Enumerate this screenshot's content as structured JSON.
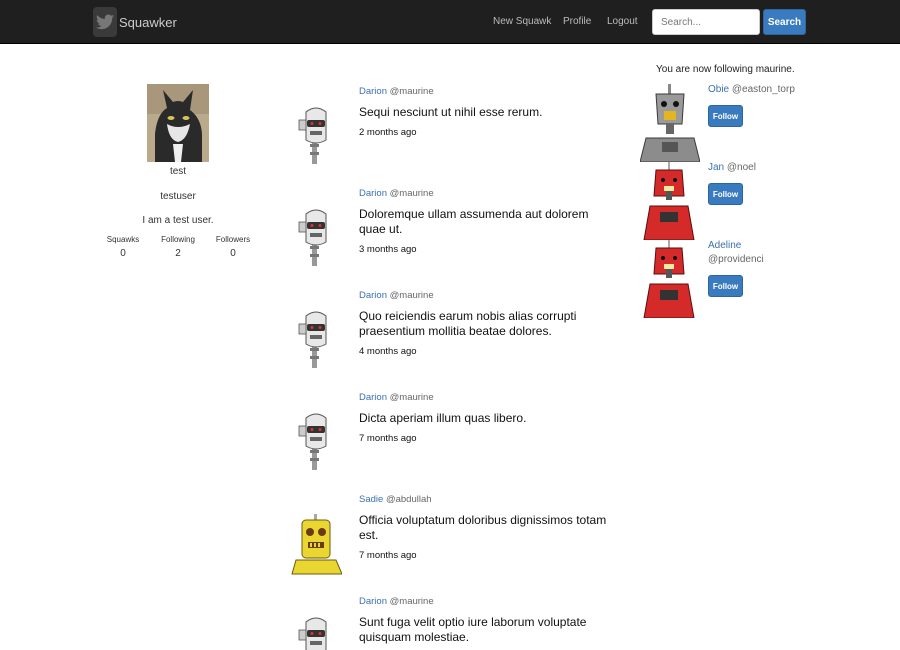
{
  "navbar": {
    "brand": "Squawker",
    "brand_icon": "twitter-bird-icon",
    "links": [
      "New Squawk",
      "Profile",
      "Logout"
    ],
    "search_placeholder": "Search...",
    "search_button": "Search"
  },
  "profile": {
    "name": "test",
    "username": "testuser",
    "bio": "I am a test user.",
    "stats": [
      {
        "label": "Squawks",
        "value": "0"
      },
      {
        "label": "Following",
        "value": "2"
      },
      {
        "label": "Followers",
        "value": "0"
      }
    ]
  },
  "feed": [
    {
      "author": "Darion",
      "handle": "@maurine",
      "text": "Sequi nesciunt ut nihil esse rerum.",
      "time": "2 months ago",
      "avatar": "gray-robot"
    },
    {
      "author": "Darion",
      "handle": "@maurine",
      "text": "Doloremque ullam assumenda aut dolorem quae ut.",
      "time": "3 months ago",
      "avatar": "gray-robot"
    },
    {
      "author": "Darion",
      "handle": "@maurine",
      "text": "Quo reiciendis earum nobis alias corrupti praesentium mollitia beatae dolores.",
      "time": "4 months ago",
      "avatar": "gray-robot"
    },
    {
      "author": "Darion",
      "handle": "@maurine",
      "text": "Dicta aperiam illum quas libero.",
      "time": "7 months ago",
      "avatar": "gray-robot"
    },
    {
      "author": "Sadie",
      "handle": "@abdullah",
      "text": "Officia voluptatum doloribus dignissimos totam est.",
      "time": "7 months ago",
      "avatar": "yellow-robot"
    },
    {
      "author": "Darion",
      "handle": "@maurine",
      "text": "Sunt fuga velit optio iure laborum voluptate quisquam molestiae.",
      "time": "",
      "avatar": "gray-robot"
    }
  ],
  "sidebar": {
    "notice": "You are now following maurine.",
    "suggestions": [
      {
        "name": "Obie",
        "handle": "@easton_torp",
        "button": "Follow",
        "avatar": "gray-robot-large"
      },
      {
        "name": "Jan",
        "handle": "@noel",
        "button": "Follow",
        "avatar": "red-robot"
      },
      {
        "name": "Adeline",
        "handle": "@providenci",
        "button": "Follow",
        "avatar": "red-robot-large"
      }
    ]
  },
  "colors": {
    "navbar": "#1f1f1f",
    "accent": "#3a7bbf",
    "link": "#3a70b0"
  }
}
